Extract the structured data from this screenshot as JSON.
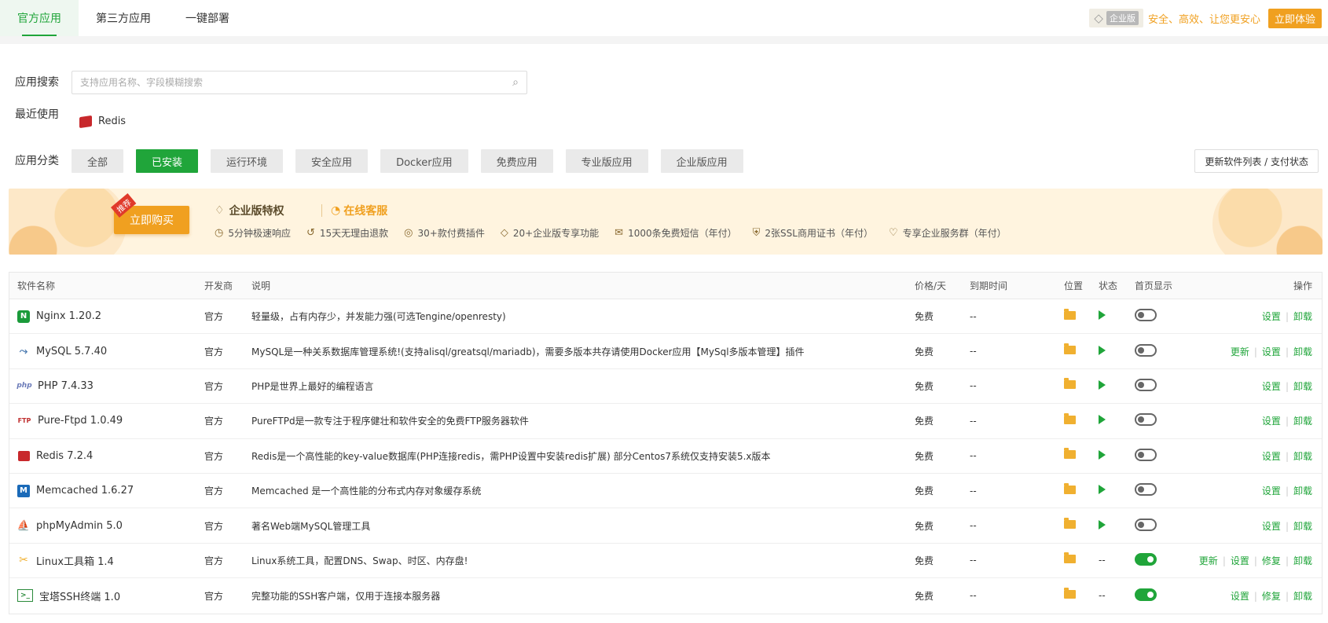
{
  "topbar": {
    "tabs": [
      {
        "label": "官方应用",
        "active": true
      },
      {
        "label": "第三方应用",
        "active": false
      },
      {
        "label": "一键部署",
        "active": false
      }
    ],
    "enterprise_badge": "企业版",
    "slogan": "安全、高效、让您更安心",
    "try_button": "立即体验"
  },
  "search": {
    "label": "应用搜索",
    "placeholder": "支持应用名称、字段模糊搜索",
    "value": ""
  },
  "recent": {
    "label": "最近使用",
    "items": [
      "Redis"
    ]
  },
  "categories": {
    "label": "应用分类",
    "items": [
      "全部",
      "已安装",
      "运行环境",
      "安全应用",
      "Docker应用",
      "免费应用",
      "专业版应用",
      "企业版应用"
    ],
    "active": "已安装",
    "refresh_label": "更新软件列表 / 支付状态"
  },
  "banner": {
    "tag": "推荐",
    "buy_button": "立即购买",
    "title": "企业版特权",
    "service": "在线客服",
    "features": [
      "5分钟极速响应",
      "15天无理由退款",
      "30+款付费插件",
      "20+企业版专享功能",
      "1000条免费短信（年付）",
      "2张SSL商用证书（年付）",
      "专享企业服务群（年付）"
    ]
  },
  "table": {
    "headers": {
      "name": "软件名称",
      "dev": "开发商",
      "desc": "说明",
      "price": "价格/天",
      "expire": "到期时间",
      "location": "位置",
      "status": "状态",
      "home": "首页显示",
      "ops": "操作"
    },
    "rows": [
      {
        "name": "Nginx 1.20.2",
        "icon": "nginx",
        "dev": "官方",
        "desc": "轻量级，占有内存少，并发能力强(可选Tengine/openresty)",
        "price": "免费",
        "expire": "--",
        "status": "play",
        "home": false,
        "ops": [
          "设置",
          "卸载"
        ]
      },
      {
        "name": "MySQL 5.7.40",
        "icon": "mysql",
        "dev": "官方",
        "desc": "MySQL是一种关系数据库管理系统!(支持alisql/greatsql/mariadb)，需要多版本共存请使用Docker应用【MySql多版本管理】插件",
        "price": "免费",
        "expire": "--",
        "status": "play",
        "home": false,
        "ops": [
          "更新",
          "设置",
          "卸载"
        ]
      },
      {
        "name": "PHP 7.4.33",
        "icon": "php",
        "dev": "官方",
        "desc": "PHP是世界上最好的编程语言",
        "price": "免费",
        "expire": "--",
        "status": "play",
        "home": false,
        "ops": [
          "设置",
          "卸载"
        ]
      },
      {
        "name": "Pure-Ftpd 1.0.49",
        "icon": "ftp",
        "dev": "官方",
        "desc": "PureFTPd是一款专注于程序健壮和软件安全的免费FTP服务器软件",
        "price": "免费",
        "expire": "--",
        "status": "play",
        "home": false,
        "ops": [
          "设置",
          "卸载"
        ]
      },
      {
        "name": "Redis 7.2.4",
        "icon": "redis",
        "dev": "官方",
        "desc": "Redis是一个高性能的key-value数据库(PHP连接redis，需PHP设置中安装redis扩展) 部分Centos7系统仅支持安装5.x版本",
        "price": "免费",
        "expire": "--",
        "status": "play",
        "home": false,
        "ops": [
          "设置",
          "卸载"
        ]
      },
      {
        "name": "Memcached 1.6.27",
        "icon": "memcached",
        "dev": "官方",
        "desc": "Memcached 是一个高性能的分布式内存对象缓存系统",
        "price": "免费",
        "expire": "--",
        "status": "play",
        "home": false,
        "ops": [
          "设置",
          "卸载"
        ]
      },
      {
        "name": "phpMyAdmin 5.0",
        "icon": "phpmyadmin",
        "dev": "官方",
        "desc": "著名Web端MySQL管理工具",
        "price": "免费",
        "expire": "--",
        "status": "play",
        "home": false,
        "ops": [
          "设置",
          "卸载"
        ]
      },
      {
        "name": "Linux工具箱 1.4",
        "icon": "tools",
        "dev": "官方",
        "desc": "Linux系统工具，配置DNS、Swap、时区、内存盘!",
        "price": "免费",
        "expire": "--",
        "status": "--",
        "home": true,
        "ops": [
          "更新",
          "设置",
          "修复",
          "卸载"
        ]
      },
      {
        "name": "宝塔SSH终端 1.0",
        "icon": "terminal",
        "dev": "官方",
        "desc": "完整功能的SSH客户端，仅用于连接本服务器",
        "price": "免费",
        "expire": "--",
        "status": "--",
        "home": true,
        "ops": [
          "设置",
          "修复",
          "卸载"
        ]
      }
    ]
  }
}
